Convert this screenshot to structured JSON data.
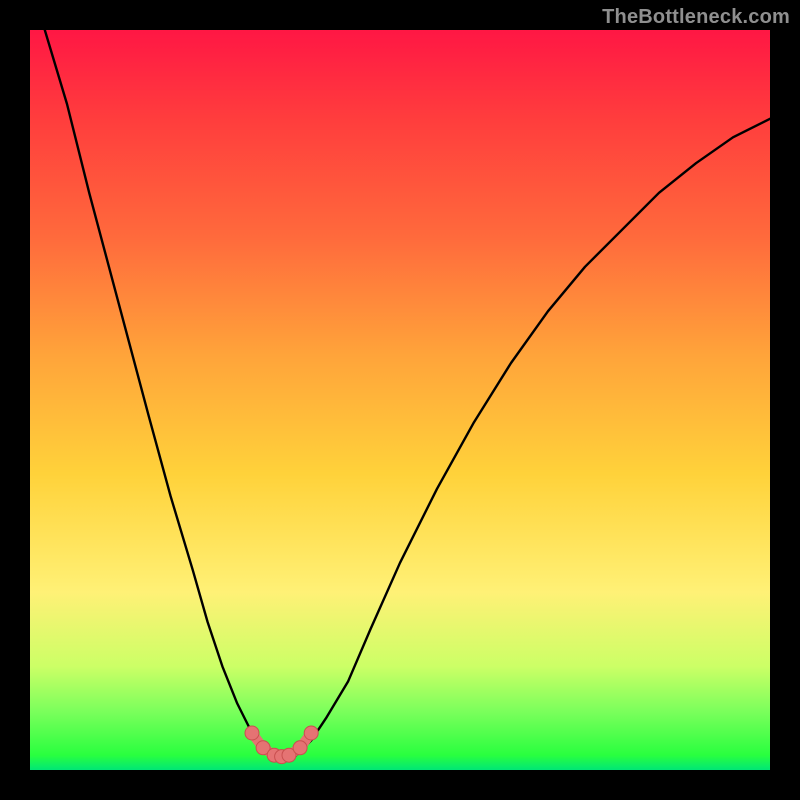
{
  "watermark": "TheBottleneck.com",
  "colors": {
    "curve": "#000000",
    "marker_fill": "#e57373",
    "marker_stroke": "#c94f4f",
    "background": "#000000",
    "gradient_top": "#ff1744",
    "gradient_bottom": "#00e676"
  },
  "chart_data": {
    "type": "line",
    "title": "",
    "xlabel": "",
    "ylabel": "",
    "xlim": [
      0,
      100
    ],
    "ylim": [
      0,
      100
    ],
    "grid": false,
    "series": [
      {
        "name": "bottleneck-curve",
        "kind": "line",
        "x": [
          2,
          5,
          8,
          12,
          16,
          19,
          22,
          24,
          26,
          28,
          30,
          31,
          33,
          34.5,
          36,
          38,
          40,
          43,
          46,
          50,
          55,
          60,
          65,
          70,
          75,
          80,
          85,
          90,
          95,
          100
        ],
        "y": [
          100,
          90,
          78,
          63,
          48,
          37,
          27,
          20,
          14,
          9,
          5,
          3,
          2,
          1.5,
          2,
          4,
          7,
          12,
          19,
          28,
          38,
          47,
          55,
          62,
          68,
          73,
          78,
          82,
          85.5,
          88
        ]
      },
      {
        "name": "bottom-arc-markers",
        "kind": "scatter",
        "x": [
          30,
          31.5,
          33,
          34,
          35,
          36.5,
          38
        ],
        "y": [
          5,
          3,
          2,
          1.8,
          2,
          3,
          5
        ]
      }
    ],
    "trough_x": 34,
    "trough_y": 1.5
  }
}
